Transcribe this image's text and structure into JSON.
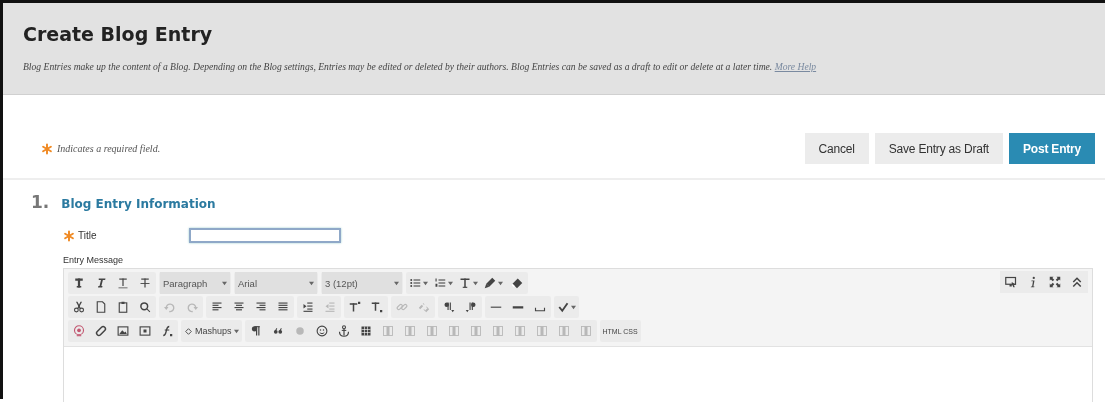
{
  "page": {
    "title": "Create Blog Entry",
    "description": "Blog Entries make up the content of a Blog. Depending on the Blog settings, Entries may be edited or deleted by their authors. Blog Entries can be saved as a draft to edit or delete at a later time.",
    "help_link": "More Help"
  },
  "required_note": "Indicates a required field.",
  "buttons": [
    {
      "label": "Cancel",
      "kind": "plain"
    },
    {
      "label": "Save Entry as Draft",
      "kind": "plain"
    },
    {
      "label": "Post Entry",
      "kind": "primary"
    }
  ],
  "section": {
    "number": "1.",
    "title": "Blog Entry Information"
  },
  "fields": [
    {
      "label": "Title",
      "required": true,
      "focused": true
    }
  ],
  "editor": {
    "label": "Entry Message",
    "toolbar": [
      [
        [
          {
            "kind": "icon",
            "disabled": false
          },
          {
            "kind": "icon",
            "disabled": false
          },
          {
            "kind": "icon",
            "disabled": false
          },
          {
            "kind": "icon",
            "disabled": false
          }
        ],
        [
          {
            "kind": "select",
            "value": "Paragraph"
          }
        ],
        [
          {
            "kind": "select",
            "value": "Arial"
          }
        ],
        [
          {
            "kind": "select",
            "value": "3 (12pt)"
          }
        ],
        [
          {
            "kind": "split",
            "disabled": false
          },
          {
            "kind": "split",
            "disabled": false
          },
          {
            "kind": "split",
            "disabled": false
          },
          {
            "kind": "split",
            "disabled": false
          },
          {
            "kind": "icon",
            "disabled": false
          }
        ]
      ],
      [
        [
          {
            "kind": "icon",
            "disabled": false
          },
          {
            "kind": "icon",
            "disabled": false
          },
          {
            "kind": "icon",
            "disabled": false
          },
          {
            "kind": "icon",
            "disabled": false
          }
        ],
        [
          {
            "kind": "icon",
            "disabled": true
          },
          {
            "kind": "icon",
            "disabled": true
          }
        ],
        [
          {
            "kind": "icon",
            "disabled": false
          },
          {
            "kind": "icon",
            "disabled": false
          },
          {
            "kind": "icon",
            "disabled": false
          },
          {
            "kind": "icon",
            "disabled": false
          }
        ],
        [
          {
            "kind": "icon",
            "disabled": false
          },
          {
            "kind": "icon",
            "disabled": true
          }
        ],
        [
          {
            "kind": "icon",
            "disabled": false
          },
          {
            "kind": "icon",
            "disabled": false
          }
        ],
        [
          {
            "kind": "icon",
            "disabled": true
          },
          {
            "kind": "icon",
            "disabled": true
          }
        ],
        [
          {
            "kind": "icon",
            "disabled": false
          },
          {
            "kind": "icon",
            "disabled": false
          }
        ],
        [
          {
            "kind": "icon",
            "disabled": false
          },
          {
            "kind": "icon",
            "disabled": false
          },
          {
            "kind": "icon",
            "disabled": false
          }
        ],
        [
          {
            "kind": "split",
            "disabled": false
          }
        ]
      ],
      [
        [
          {
            "kind": "icon",
            "disabled": false
          },
          {
            "kind": "icon",
            "disabled": false
          },
          {
            "kind": "icon",
            "disabled": false
          },
          {
            "kind": "icon",
            "disabled": false
          },
          {
            "kind": "icon",
            "disabled": false
          }
        ],
        [
          {
            "kind": "menu",
            "label": "Mashups"
          }
        ],
        [
          {
            "kind": "icon",
            "disabled": false
          },
          {
            "kind": "icon",
            "disabled": false
          },
          {
            "kind": "icon",
            "disabled": true
          },
          {
            "kind": "icon",
            "disabled": false
          },
          {
            "kind": "icon",
            "disabled": false
          },
          {
            "kind": "icon",
            "disabled": false
          },
          {
            "kind": "icon",
            "disabled": true
          },
          {
            "kind": "icon",
            "disabled": true
          },
          {
            "kind": "icon",
            "disabled": true
          },
          {
            "kind": "icon",
            "disabled": true
          },
          {
            "kind": "icon",
            "disabled": true
          },
          {
            "kind": "icon",
            "disabled": true
          },
          {
            "kind": "icon",
            "disabled": true
          },
          {
            "kind": "icon",
            "disabled": true
          },
          {
            "kind": "icon",
            "disabled": true
          },
          {
            "kind": "icon",
            "disabled": true
          }
        ],
        [
          {
            "kind": "text",
            "label": "HTML CSS"
          }
        ]
      ]
    ],
    "side_tools": [
      {
        "kind": "icon",
        "disabled": false
      },
      {
        "kind": "icon",
        "disabled": false
      },
      {
        "kind": "icon",
        "disabled": false
      },
      {
        "kind": "icon",
        "disabled": false
      }
    ]
  }
}
